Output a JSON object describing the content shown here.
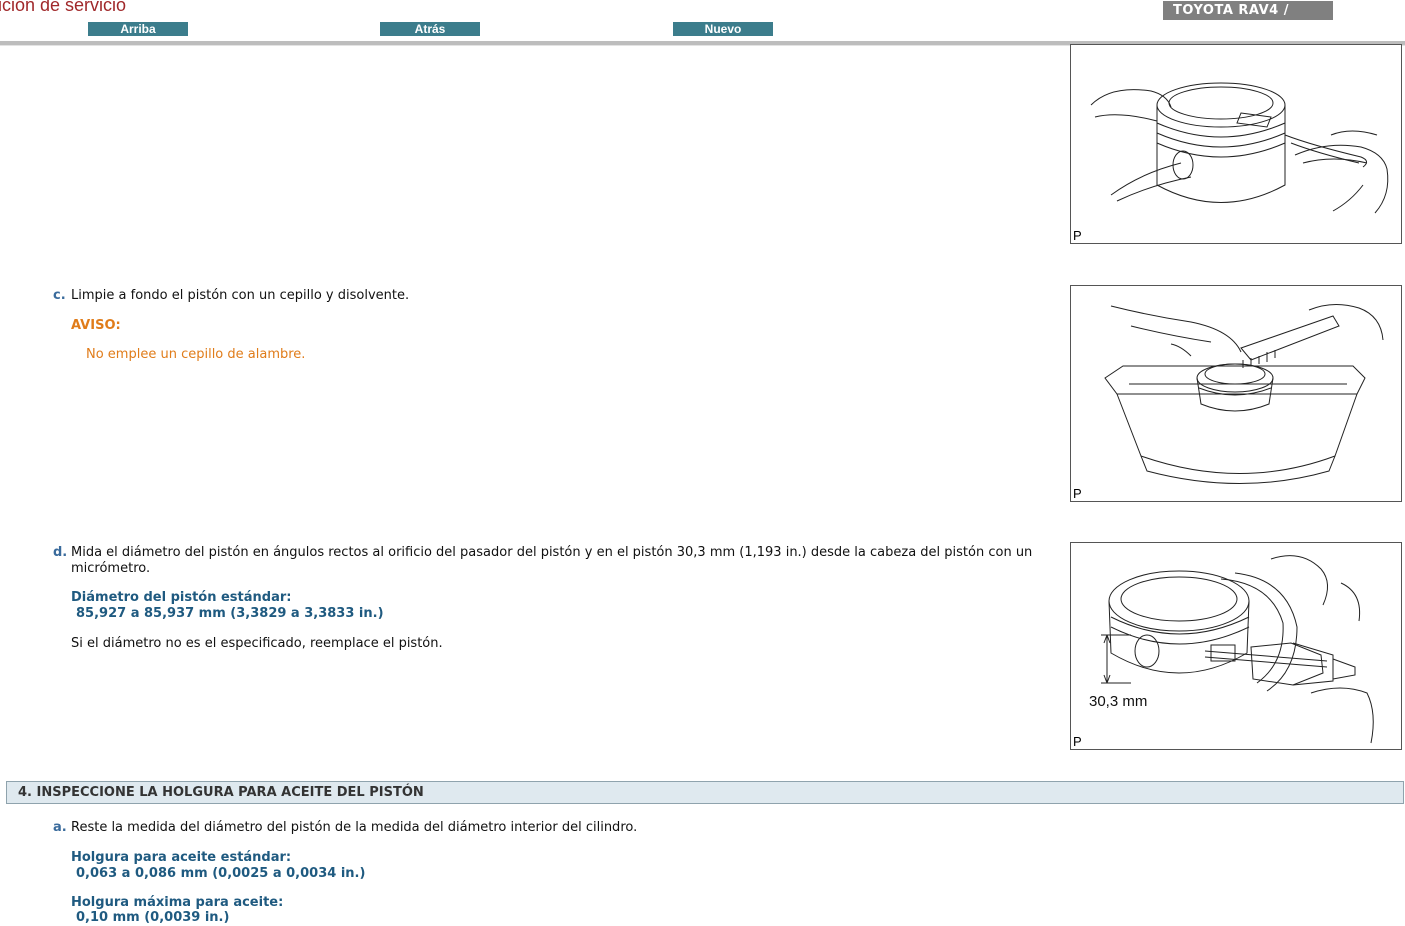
{
  "header": {
    "title_fragment": "ición de servicio",
    "nav": {
      "up": "Arriba",
      "back": "Atrás",
      "new": "Nuevo"
    },
    "brand": "TOYOTA RAV4 /"
  },
  "figures": {
    "fig1_label": "P",
    "fig2_label": "P",
    "fig3_label": "P",
    "fig3_dimension": "30,3 mm"
  },
  "steps": {
    "c": {
      "letter": "c.",
      "text": "Limpie a fondo el pistón con un cepillo y disolvente.",
      "notice_title": "AVISO:",
      "notice_text": "No emplee un cepillo de alambre."
    },
    "d": {
      "letter": "d.",
      "text": "Mida el diámetro del pistón en ángulos rectos al orificio del pasador del pistón y en el pistón 30,3 mm (1,193 in.) desde la cabeza del pistón con un micrómetro.",
      "spec_title": "Diámetro del pistón estándar:",
      "spec_value": "85,927 a 85,937 mm (3,3829 a 3,3833 in.)",
      "note": "Si el diámetro no es el especificado, reemplace el pistón."
    }
  },
  "section4": {
    "title": "4. INSPECCIONE LA HOLGURA PARA ACEITE DEL PISTÓN",
    "a": {
      "letter": "a.",
      "text": "Reste la medida del diámetro del pistón de la medida del diámetro interior del cilindro.",
      "spec1_title": "Holgura para aceite estándar:",
      "spec1_value": "0,063 a 0,086 mm (0,0025 a 0,0034 in.)",
      "spec2_title": "Holgura máxima para aceite:",
      "spec2_value": "0,10 mm (0,0039 in.)"
    }
  }
}
